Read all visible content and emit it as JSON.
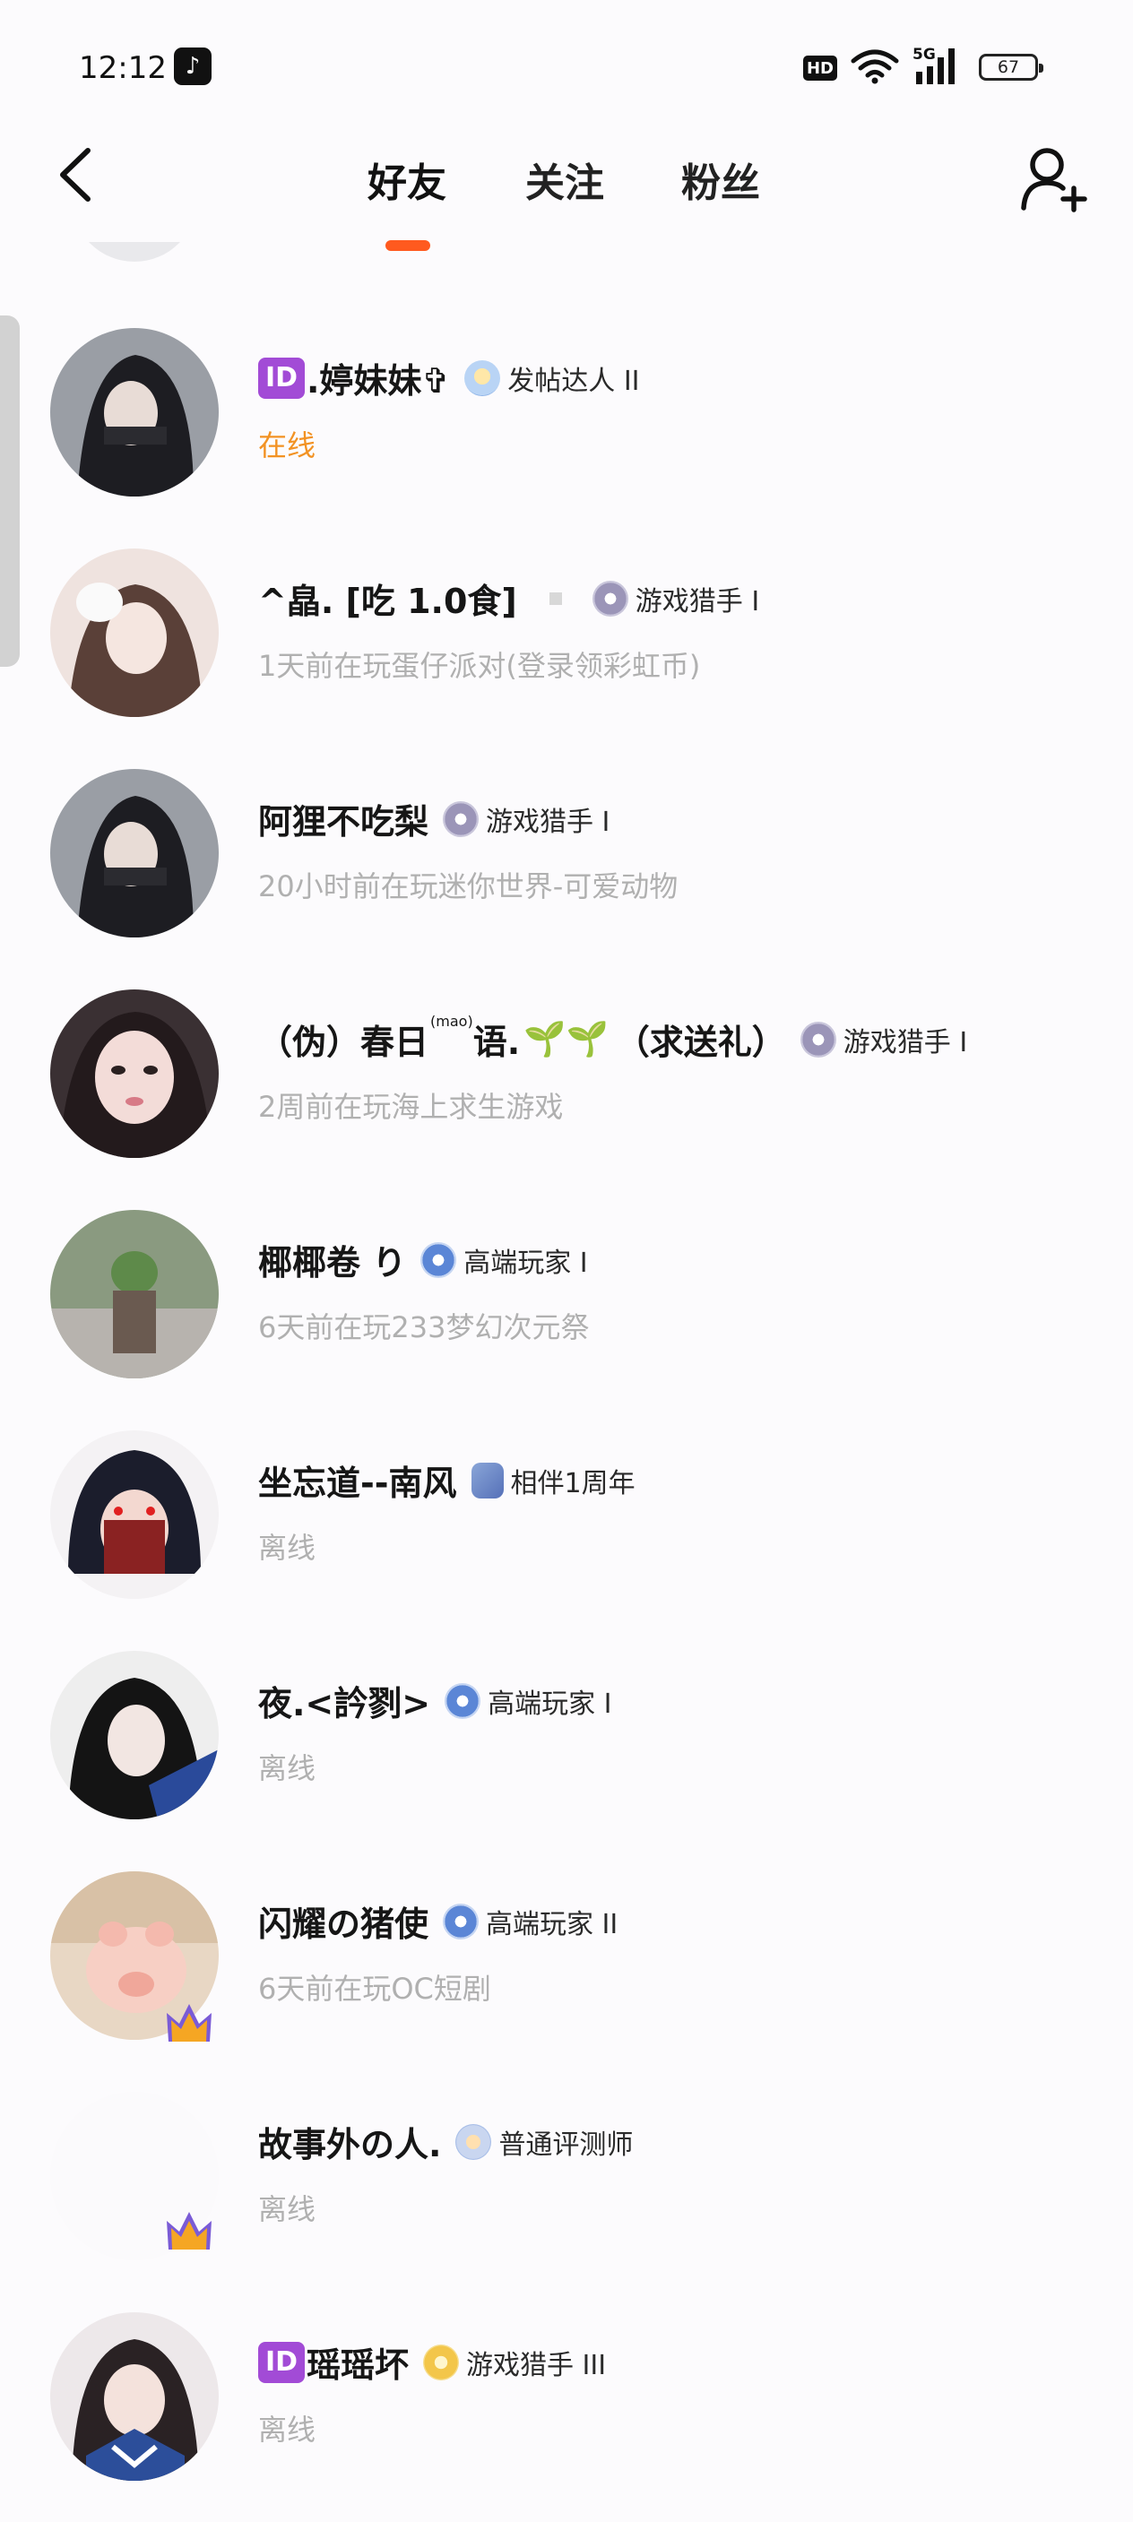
{
  "status_bar": {
    "time": "12:12",
    "hd": "HD",
    "signal": "5G",
    "battery": "67"
  },
  "tabs": [
    {
      "label": "好友",
      "active": true
    },
    {
      "label": "关注",
      "active": false
    },
    {
      "label": "粉丝",
      "active": false
    }
  ],
  "colors": {
    "accent": "#ff5a1f",
    "online": "#f29223",
    "id_badge": "#a24bd6",
    "muted": "#b0b0b0"
  },
  "friends": [
    {
      "id_badge": "ID",
      "name": ".婷妹妹✞",
      "medal_icon": "post-medal-icon",
      "medal": "发帖达人 II",
      "status": "在线",
      "online": true
    },
    {
      "name": "^皛. [吃 1.0食]",
      "medal_icon": "hunter-medal-icon",
      "medal": "游戏猎手 I",
      "status": "1天前在玩蛋仔派对(登录领彩虹币)"
    },
    {
      "name": "阿狸不吃梨",
      "medal_icon": "hunter-medal-icon",
      "medal": "游戏猎手 I",
      "status": "20小时前在玩迷你世界-可爱动物"
    },
    {
      "name": "（伪）春日",
      "name_deco": "(mao)",
      "name_mid": "语.",
      "name_tail": "（求送礼）",
      "medal_icon": "hunter-medal-icon",
      "medal": "游戏猎手 I",
      "status": "2周前在玩海上求生游戏"
    },
    {
      "name": "椰椰卷 り",
      "medal_icon": "pro-medal-icon",
      "medal": "高端玩家 I",
      "status": "6天前在玩233梦幻次元祭"
    },
    {
      "name": "坐忘道--南风",
      "medal_icon": "year-medal-icon",
      "medal": "相伴1周年",
      "status": "离线"
    },
    {
      "name": "夜.<訡剹>",
      "medal_icon": "pro-medal-icon",
      "medal": "高端玩家 I",
      "status": "离线"
    },
    {
      "name": "闪耀の猪使",
      "medal_icon": "pro-medal-icon",
      "medal": "高端玩家 II",
      "status": "6天前在玩OC短剧",
      "crown": true
    },
    {
      "name": "故事外の人.",
      "medal_icon": "review-medal-icon",
      "medal": "普通评测师",
      "status": "离线",
      "crown": true
    },
    {
      "id_badge": "ID",
      "name": "瑶瑶坏",
      "medal_icon": "hunter-gold-medal-icon",
      "medal": "游戏猎手 III",
      "status": "离线"
    }
  ]
}
